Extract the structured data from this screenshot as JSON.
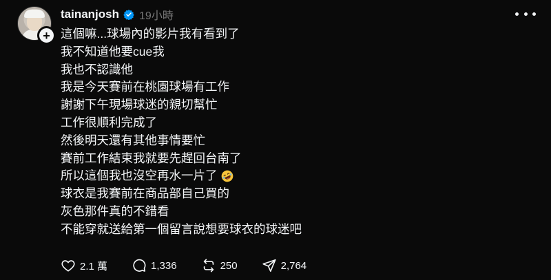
{
  "post": {
    "username": "tainanjosh",
    "time": "19小時",
    "verified_icon": "verified-badge-icon",
    "lines": [
      "這個嘛...球場內的影片我有看到了",
      "我不知道他要cue我",
      "我也不認識他",
      "我是今天賽前在桃園球場有工作",
      "謝謝下午現場球迷的親切幫忙",
      "工作很順利完成了",
      "然後明天還有其他事情要忙",
      "賽前工作結束我就要先趕回台南了",
      "所以這個我也沒空再水一片了",
      "球衣是我賽前在商品部自己買的",
      "灰色那件真的不錯看",
      "不能穿就送給第一個留言說想要球衣的球迷吧"
    ],
    "emoji": "rolling-on-the-floor-laughing-emoji"
  },
  "actions": {
    "likes": "2.1 萬",
    "comments": "1,336",
    "reposts": "250",
    "shares": "2,764"
  },
  "colors": {
    "background": "#0a0a0a",
    "text": "#f3f5f7",
    "muted": "#777777",
    "verified": "#0095f6"
  }
}
